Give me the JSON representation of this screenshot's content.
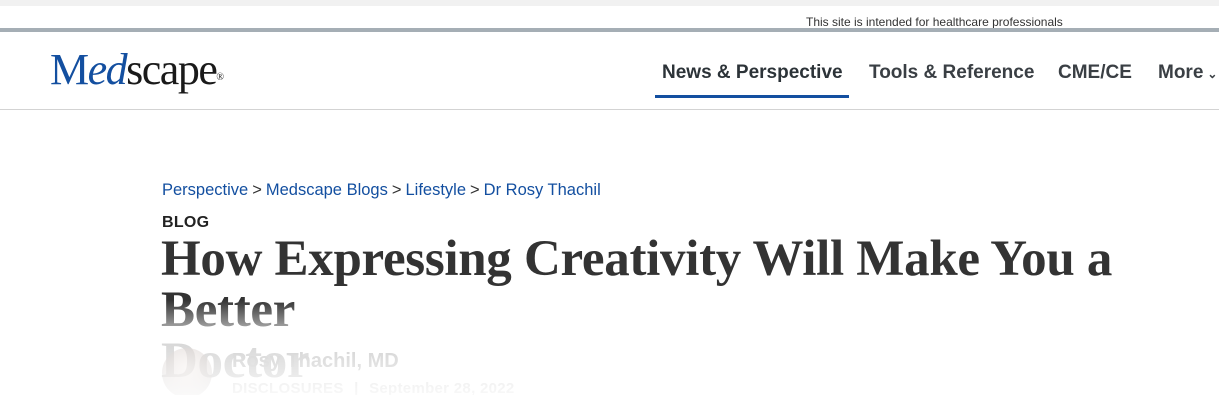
{
  "notice": "This site is intended for healthcare professionals",
  "logo": {
    "prefix": "M",
    "italic": "ed",
    "rest": "scape",
    "reg": "®"
  },
  "nav": {
    "items": [
      {
        "label": "News & Perspective"
      },
      {
        "label": "Tools & Reference"
      },
      {
        "label": "CME/CE"
      },
      {
        "label": "More"
      }
    ],
    "active_index": 0
  },
  "breadcrumb": {
    "items": [
      {
        "label": "Perspective"
      },
      {
        "label": "Medscape Blogs"
      },
      {
        "label": "Lifestyle"
      },
      {
        "label": "Dr Rosy Thachil"
      }
    ],
    "separator": ">"
  },
  "article": {
    "kicker": "BLOG",
    "title_line1": "How Expressing Creativity Will Make You a Better",
    "title_line2": "Doctor",
    "author": "Rosy Thachil, MD",
    "disclosures": "DISCLOSURES",
    "date": "September 28, 2022",
    "meta_separator": "|"
  },
  "colors": {
    "brand_blue": "#134fa0",
    "nav_text": "#3a3f44",
    "divider": "#a5aeb5"
  }
}
